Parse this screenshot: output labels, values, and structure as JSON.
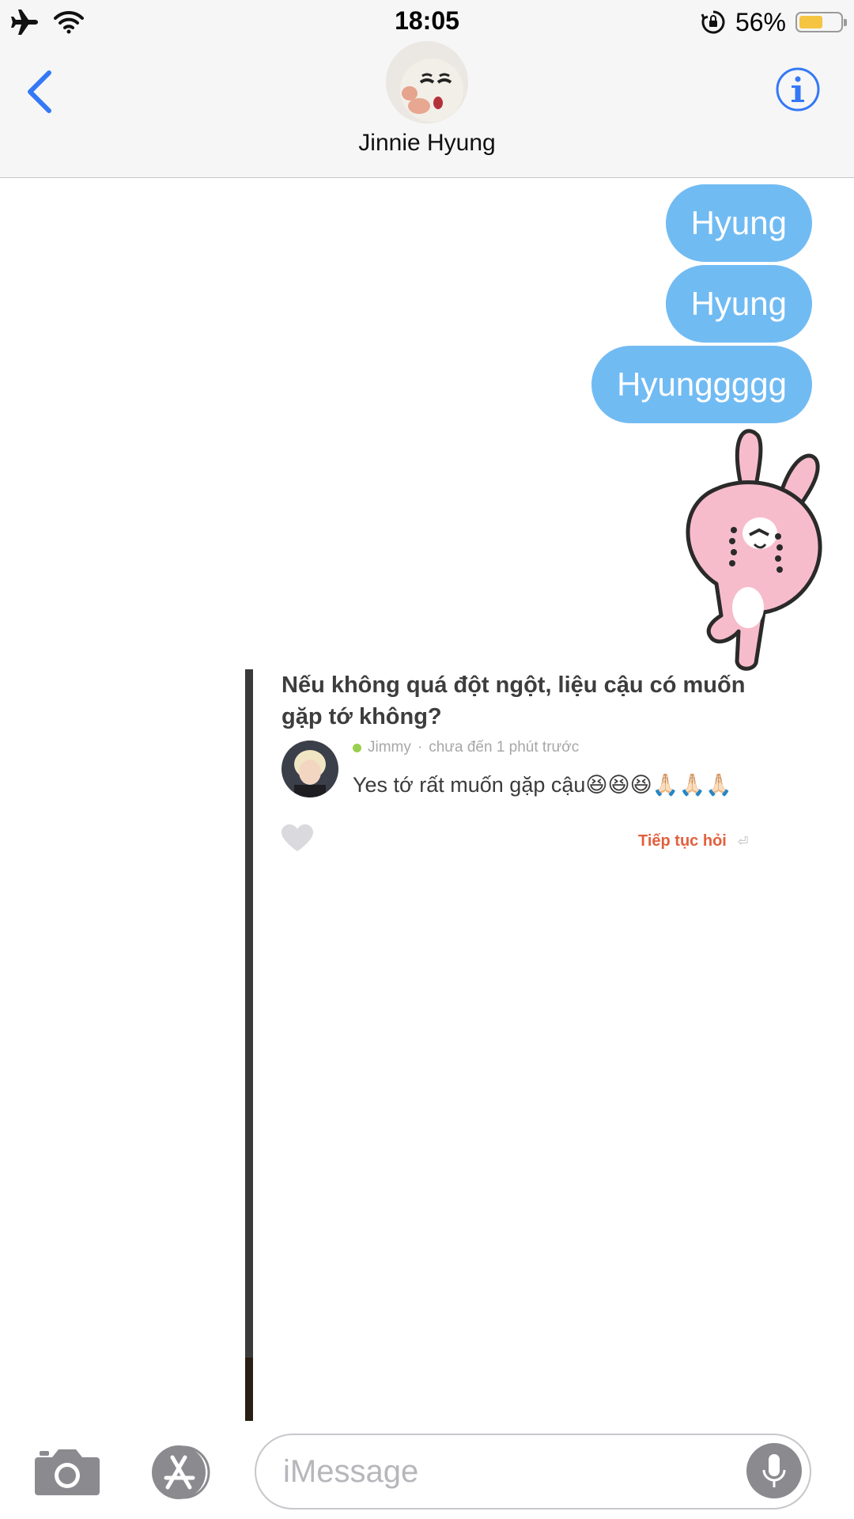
{
  "status_bar": {
    "time": "18:05",
    "battery_percent": "56%",
    "battery_level": 0.56,
    "icons": [
      "airplane-icon",
      "wifi-icon",
      "orientation-lock-icon",
      "battery-icon"
    ]
  },
  "header": {
    "contact_name": "Jinnie Hyung",
    "back_icon": "chevron-left-icon",
    "info_icon": "info-icon"
  },
  "messages": [
    {
      "text": "Hyung"
    },
    {
      "text": "Hyung"
    },
    {
      "text": "Hyunggggg"
    }
  ],
  "sticker": {
    "icon": "pink-rabbit-crying-sticker"
  },
  "shared_card": {
    "question": "Nếu không quá đột ngột, liệu cậu có muốn gặp tớ không?",
    "author": "Jimmy",
    "time_ago": "chưa đến 1 phút trước",
    "answer": "Yes tớ rất muốn gặp cậu😆😆😆🙏🏻🙏🏻🙏🏻",
    "continue_label": "Tiếp tục hỏi"
  },
  "input_bar": {
    "placeholder": "iMessage"
  },
  "colors": {
    "bubble": "#71bbf3",
    "ios_blue": "#3478f6",
    "continue_orange": "#e2603e"
  }
}
